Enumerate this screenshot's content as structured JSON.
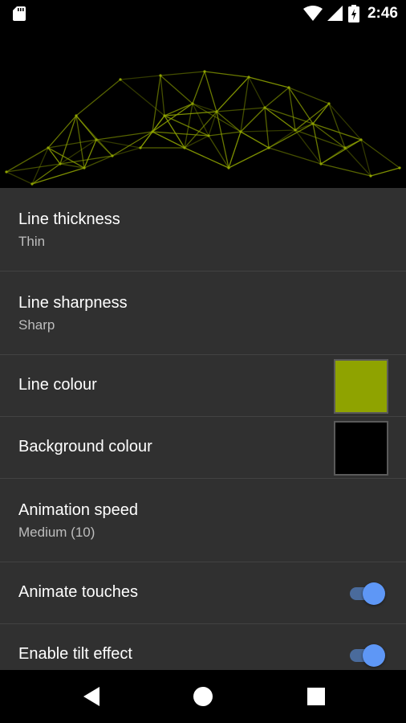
{
  "status_bar": {
    "time": "2:46"
  },
  "settings": [
    {
      "title": "Line thickness",
      "summary": "Thin"
    },
    {
      "title": "Line sharpness",
      "summary": "Sharp"
    },
    {
      "title": "Line colour",
      "swatch": "#8fa300"
    },
    {
      "title": "Background colour",
      "swatch": "#000000"
    },
    {
      "title": "Animation speed",
      "summary": "Medium (10)"
    },
    {
      "title": "Animate touches",
      "toggle": true
    },
    {
      "title": "Enable tilt effect",
      "toggle": true
    }
  ],
  "colors": {
    "line": "#8fa300",
    "accent": "#5e97f6",
    "background": "#303030"
  },
  "icons": {
    "status": [
      "sd-card-icon",
      "wifi-icon",
      "cell-signal-icon",
      "battery-icon"
    ],
    "nav": [
      "back-icon",
      "home-icon",
      "recents-icon"
    ]
  }
}
